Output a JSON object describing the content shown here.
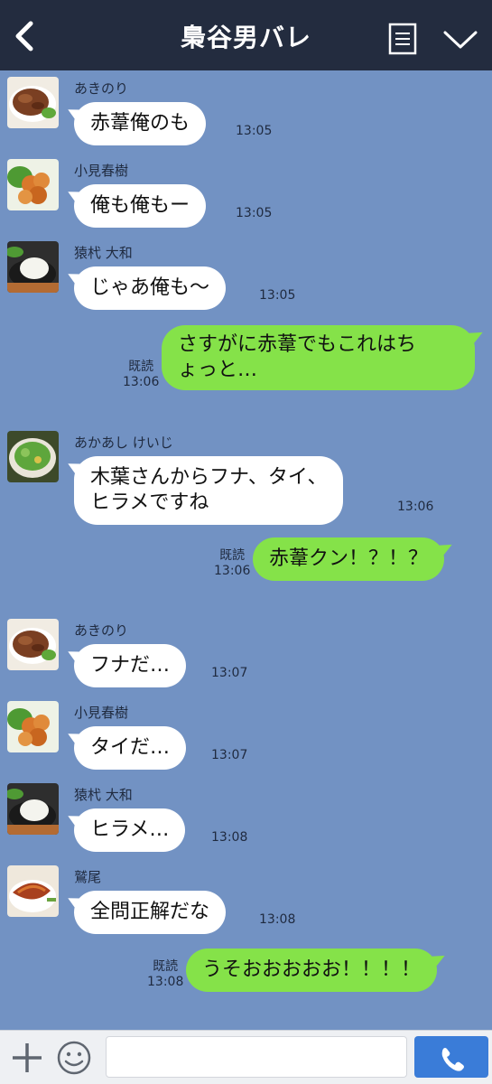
{
  "header": {
    "title": "梟谷男バレ",
    "back_icon": "chevron-left-icon",
    "note_icon": "note-icon",
    "menu_icon": "chevron-down-icon"
  },
  "colors": {
    "header_bg": "#232c3f",
    "chat_bg": "#7292c3",
    "incoming_bubble": "#ffffff",
    "outgoing_bubble": "#85e249",
    "call_button": "#3a7cd8"
  },
  "read_label": "既読",
  "messages": [
    {
      "sender": "あきのり",
      "text": "赤葦俺のも",
      "time": "13:05",
      "avatar": "beef-dish-avatar"
    },
    {
      "sender": "小見春樹",
      "text": "俺も俺もー",
      "time": "13:05",
      "avatar": "karaage-avatar"
    },
    {
      "sender": "猿杙 大和",
      "text": "じゃあ俺も〜",
      "time": "13:05",
      "avatar": "grated-radish-avatar"
    },
    {
      "text": "さすがに赤葦でもこれはち\nょっと…",
      "time": "13:06",
      "read": "既読"
    },
    {
      "sender": "あかあし けいじ",
      "text": "木葉さんからフナ、タイ、\nヒラメですね",
      "time": "13:06",
      "avatar": "greens-avatar"
    },
    {
      "text": "赤葦クン！？！？",
      "time": "13:06",
      "read": "既読"
    },
    {
      "sender": "あきのり",
      "text": "フナだ…",
      "time": "13:07",
      "avatar": "beef-dish-avatar"
    },
    {
      "sender": "小見春樹",
      "text": "タイだ…",
      "time": "13:07",
      "avatar": "karaage-avatar"
    },
    {
      "sender": "猿杙 大和",
      "text": "ヒラメ…",
      "time": "13:08",
      "avatar": "grated-radish-avatar"
    },
    {
      "sender": "鷲尾",
      "text": "全問正解だな",
      "time": "13:08",
      "avatar": "grilled-fish-avatar"
    },
    {
      "text": "うそおおおおお！！！！",
      "time": "13:08",
      "read": "既読"
    }
  ],
  "footer": {
    "input_placeholder": "",
    "plus_icon": "plus-icon",
    "emoji_icon": "smiley-icon",
    "call_icon": "phone-icon"
  }
}
